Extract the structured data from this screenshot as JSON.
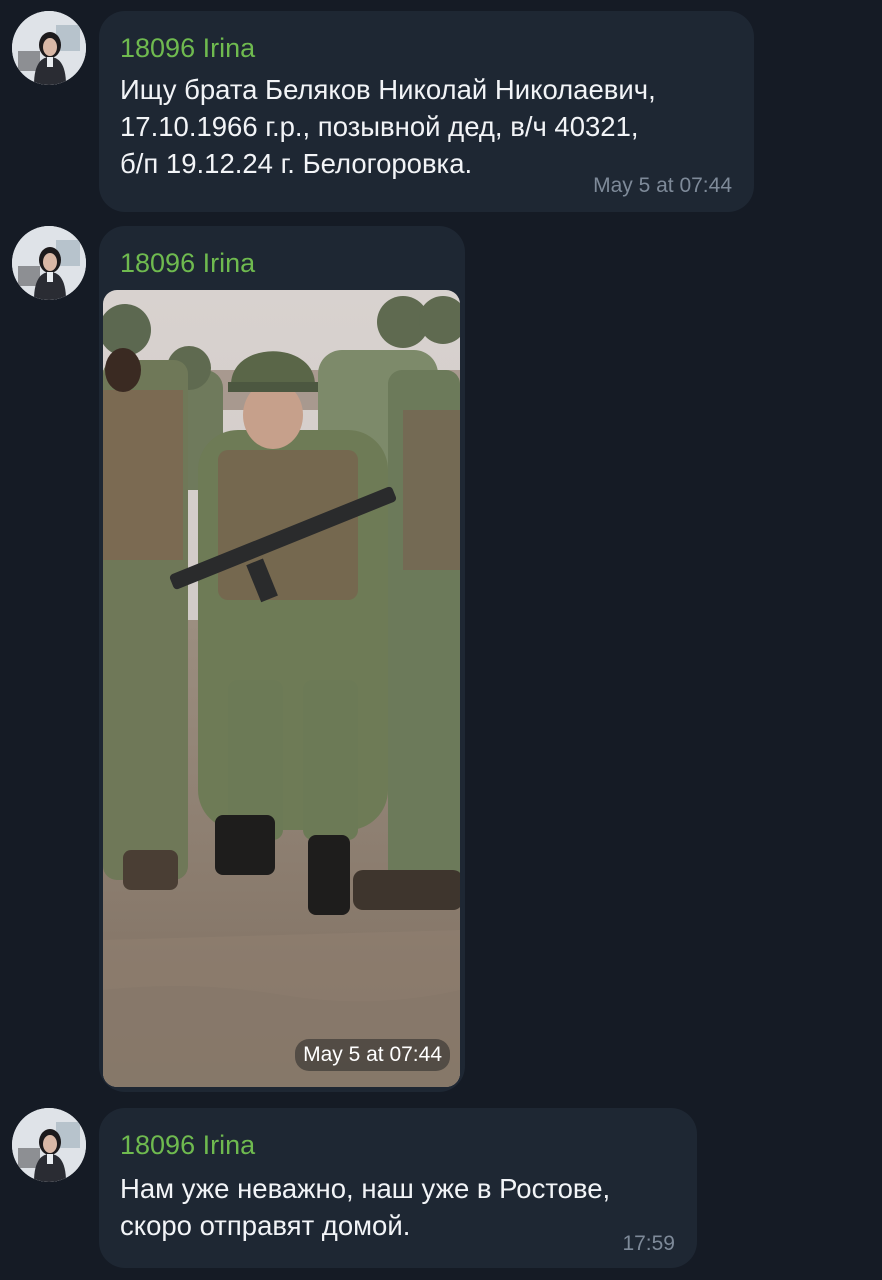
{
  "messages": [
    {
      "sender": "18096 Irina",
      "text_lines": [
        "Ищу брата Беляков Николай Николаевич,",
        "17.10.1966 г.р., позывной дед, в/ч 40321,",
        "б/п 19.12.24 г. Белогоровка."
      ],
      "time": "May 5 at 07:44"
    },
    {
      "sender": "18096 Irina",
      "photo_caption_time": "May 5 at 07:44"
    },
    {
      "sender": "18096 Irina",
      "text_lines": [
        "Нам уже неважно, наш уже в Ростове,",
        "скоро отправят домой."
      ],
      "time": "17:59"
    }
  ],
  "colors": {
    "background": "#151b25",
    "bubble": "#1e2733",
    "sender_name": "#6fba4f",
    "message_text": "#f2f4f7",
    "timestamp": "#7e8a99"
  },
  "icons": [
    "user-avatar-photo",
    "soldiers-photo"
  ]
}
